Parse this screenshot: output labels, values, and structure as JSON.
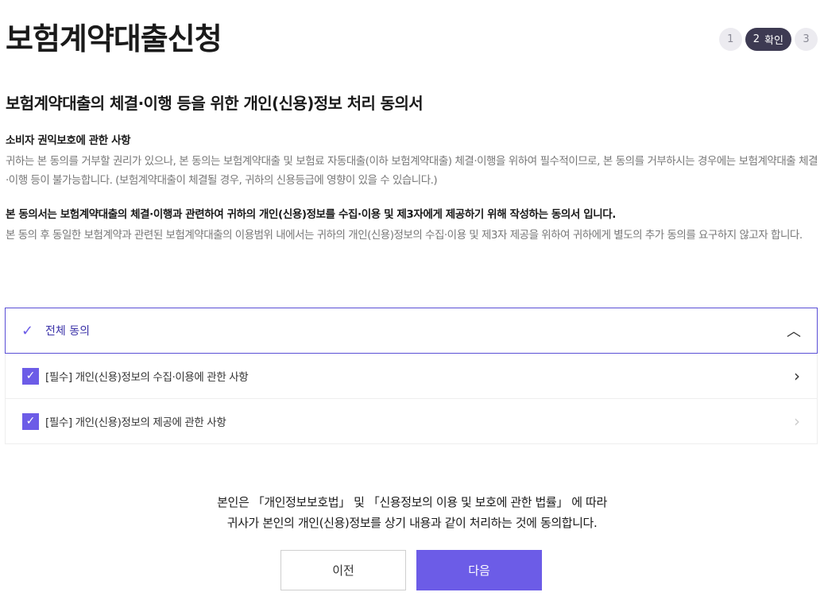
{
  "page": {
    "title": "보험계약대출신청"
  },
  "steps": {
    "step1": "1",
    "step2_num": "2",
    "step2_label": "확인",
    "step3": "3"
  },
  "consent": {
    "title": "보험계약대출의 체결·이행 등을 위한 개인(신용)정보 처리 동의서",
    "section1": {
      "heading": "소비자 권익보호에 관한 사항",
      "body": "귀하는 본 동의를 거부할 권리가 있으나, 본 동의는 보험계약대출 및 보험료 자동대출(이하 보험계약대출) 체결·이행을 위하여 필수적이므로, 본 동의를 거부하시는 경우에는 보험계약대출 체결·이행 등이 불가능합니다. (보험계약대출이 체결될 경우, 귀하의 신용등급에 영향이 있을 수 있습니다.)"
    },
    "section2": {
      "heading": "본 동의서는 보험계약대출의 체결·이행과 관련하여 귀하의 개인(신용)정보를 수집·이용 및 제3자에게 제공하기 위해 작성하는 동의서 입니다.",
      "body": "본 동의 후 동일한 보험계약과 관련된 보험계약대출의 이용범위 내에서는 귀하의 개인(신용)정보의 수집·이용 및 제3자 제공을 위하여 귀하에게 별도의 추가 동의를 요구하지 않고자 합니다."
    }
  },
  "accordion": {
    "all_label": "전체 동의",
    "items": [
      {
        "label": "[필수] 개인(신용)정보의 수집·이용에 관한 사항"
      },
      {
        "label": "[필수] 개인(신용)정보의 제공에 관한 사항"
      }
    ]
  },
  "agreement": {
    "line1": "본인은 「개인정보보호법」 및 「신용정보의 이용 및 보호에 관한 법률」 에 따라",
    "line2": "귀사가 본인의 개인(신용)정보를 상기 내용과 같이 처리하는 것에 동의합니다."
  },
  "buttons": {
    "prev": "이전",
    "next": "다음"
  },
  "colors": {
    "accent": "#6c5ce7",
    "step_active": "#3d3a52"
  }
}
